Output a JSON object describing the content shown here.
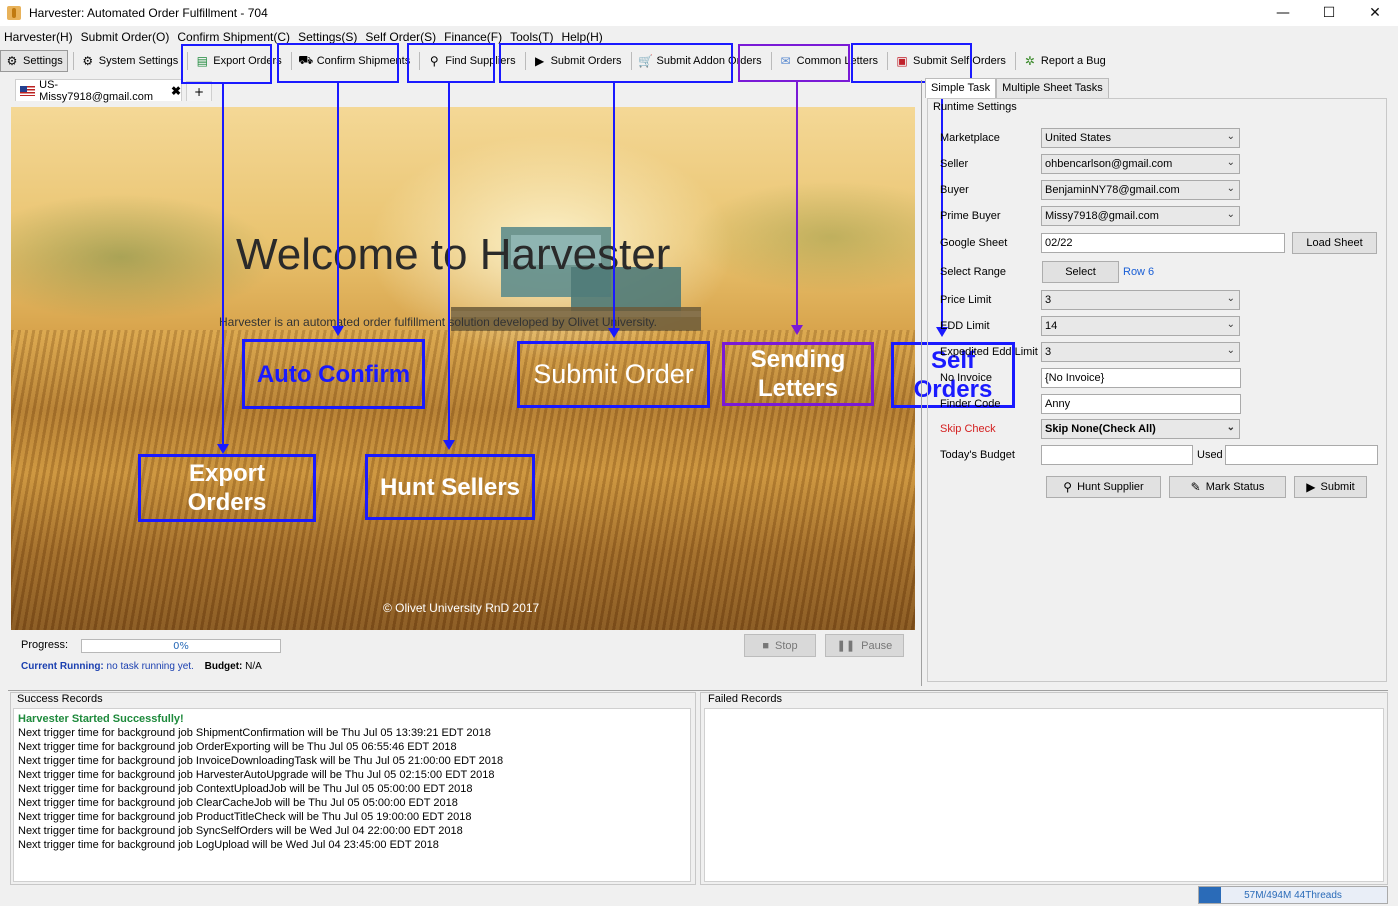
{
  "window": {
    "title": "Harvester: Automated Order Fulfillment - 704",
    "minimize": "—",
    "maximize": "☐",
    "close": "✕"
  },
  "menu": [
    "Harvester(H)",
    "Submit Order(O)",
    "Confirm Shipment(C)",
    "Settings(S)",
    "Self Order(S)",
    "Finance(F)",
    "Tools(T)",
    "Help(H)"
  ],
  "toolbar": {
    "settings": "Settings",
    "system_settings": "System Settings",
    "export_orders": "Export Orders",
    "confirm_shipments": "Confirm Shipments",
    "find_suppliers": "Find Suppliers",
    "submit_orders": "Submit Orders",
    "submit_addon_orders": "Submit Addon Orders",
    "common_letters": "Common Letters",
    "submit_self_orders": "Submit Self Orders",
    "report_bug": "Report a Bug"
  },
  "annotations": {
    "auto_confirm": "Auto Confirm",
    "export_orders": "Export\nOrders",
    "hunt_sellers": "Hunt Sellers",
    "submit_order": "Submit Order",
    "sending_letters": "Sending\nLetters",
    "self_orders": "Self\nOrders"
  },
  "account_tab": {
    "label": "US-Missy7918@gmail.com",
    "close": "✖",
    "add": "+"
  },
  "hero": {
    "welcome": "Welcome to Harvester",
    "subtitle": "Harvester is an automated order fulfillment solution developed by Olivet University.",
    "copyright": "© Olivet University RnD 2017"
  },
  "progress": {
    "label": "Progress:",
    "value": 0,
    "text": "0%"
  },
  "running": {
    "label": "Current Running:",
    "value": "no task running yet.",
    "budget_label": "Budget:",
    "budget_value": "N/A"
  },
  "controls": {
    "stop": "Stop",
    "pause": "Pause"
  },
  "right_panel": {
    "tabs": [
      "Simple Task",
      "Multiple Sheet Tasks"
    ],
    "group_title": "Runtime Settings",
    "fields": {
      "marketplace": {
        "label": "Marketplace",
        "value": "United States"
      },
      "seller": {
        "label": "Seller",
        "value": "ohbencarlson@gmail.com"
      },
      "buyer": {
        "label": "Buyer",
        "value": "BenjaminNY78@gmail.com"
      },
      "prime_buyer": {
        "label": "Prime Buyer",
        "value": "Missy7918@gmail.com"
      },
      "google_sheet": {
        "label": "Google Sheet",
        "value": "02/22",
        "button": "Load Sheet"
      },
      "select_range": {
        "label": "Select Range",
        "button": "Select",
        "row": "Row 6"
      },
      "price_limit": {
        "label": "Price Limit",
        "value": "3"
      },
      "edd_limit": {
        "label": "EDD Limit",
        "value": "14"
      },
      "expedited_edd_limit": {
        "label": "Expedited Edd Limit",
        "value": "3"
      },
      "no_invoice": {
        "label": "No Invoice",
        "value": "{No Invoice}"
      },
      "finder_code": {
        "label": "Finder Code",
        "value": "Anny"
      },
      "skip_check": {
        "label": "Skip Check",
        "value": "Skip None(Check All)"
      },
      "todays_budget": {
        "label": "Today's Budget",
        "value": "",
        "used_label": "Used",
        "used_value": ""
      }
    },
    "buttons": {
      "hunt_supplier": "Hunt Supplier",
      "mark_status": "Mark Status",
      "submit": "Submit"
    }
  },
  "success_records": {
    "title": "Success Records",
    "lines": [
      "Harvester Started Successfully!",
      "Next trigger time for background job ShipmentConfirmation will be Thu Jul 05 13:39:21 EDT 2018",
      "Next trigger time for background job OrderExporting will be Thu Jul 05 06:55:46 EDT 2018",
      "Next trigger time for background job InvoiceDownloadingTask will be Thu Jul 05 21:00:00 EDT 2018",
      "Next trigger time for background job HarvesterAutoUpgrade will be Thu Jul 05 02:15:00 EDT 2018",
      "Next trigger time for background job ContextUploadJob will be Thu Jul 05 05:00:00 EDT 2018",
      "Next trigger time for background job ClearCacheJob will be Thu Jul 05 05:00:00 EDT 2018",
      "Next trigger time for background job ProductTitleCheck will be Thu Jul 05 19:00:00 EDT 2018",
      "Next trigger time for background job SyncSelfOrders will be Wed Jul 04 22:00:00 EDT 2018",
      "Next trigger time for background job LogUpload will be Wed Jul 04 23:45:00 EDT 2018"
    ]
  },
  "failed_records": {
    "title": "Failed Records",
    "lines": []
  },
  "status": {
    "memory": "57M/494M 44Threads",
    "memory_fraction": 0.115
  },
  "colors": {
    "annotation_blue": "#1a1aff",
    "annotation_purple": "#7a1ad6",
    "accent": "#2a6bb8",
    "success": "#1e8a3c"
  }
}
